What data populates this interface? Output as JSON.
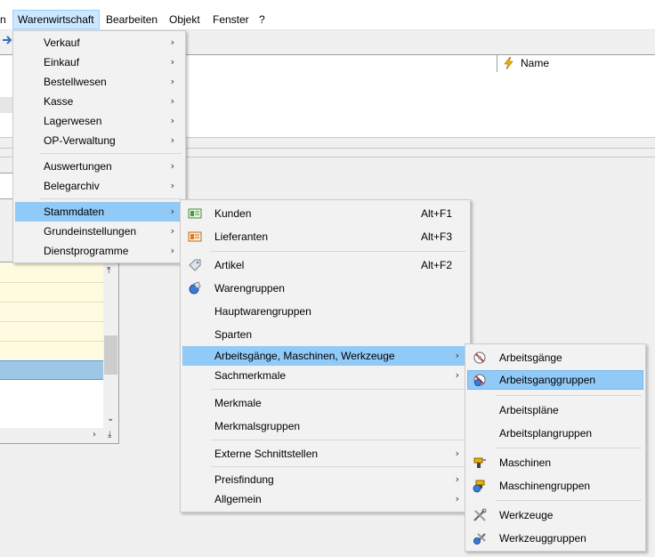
{
  "menubar": {
    "items": [
      "n",
      "Warenwirtschaft",
      "Bearbeiten",
      "Objekt",
      "Fenster",
      "?"
    ]
  },
  "grid": {
    "name_header": "Name"
  },
  "menu1": {
    "items": [
      {
        "label": "Verkauf",
        "arrow": "›"
      },
      {
        "label": "Einkauf",
        "arrow": "›"
      },
      {
        "label": "Bestellwesen",
        "arrow": "›"
      },
      {
        "label": "Kasse",
        "arrow": "›"
      },
      {
        "label": "Lagerwesen",
        "arrow": "›"
      },
      {
        "label": "OP-Verwaltung",
        "arrow": "›"
      },
      {
        "label": "Auswertungen",
        "arrow": "›"
      },
      {
        "label": "Belegarchiv",
        "arrow": "›"
      },
      {
        "label": "Stammdaten",
        "arrow": "›"
      },
      {
        "label": "Grundeinstellungen",
        "arrow": "›"
      },
      {
        "label": "Dienstprogramme",
        "arrow": "›"
      }
    ]
  },
  "menu2": {
    "items": [
      {
        "label": "Kunden",
        "shortcut": "Alt+F1",
        "icon": "customer-card-icon"
      },
      {
        "label": "Lieferanten",
        "shortcut": "Alt+F3",
        "icon": "supplier-card-icon"
      },
      {
        "label": "Artikel",
        "shortcut": "Alt+F2",
        "icon": "article-tag-icon"
      },
      {
        "label": "Warengruppen",
        "icon": "product-group-icon"
      },
      {
        "label": "Hauptwarengruppen"
      },
      {
        "label": "Sparten"
      },
      {
        "label": "Arbeitsgänge, Maschinen, Werkzeuge",
        "arrow": "›"
      },
      {
        "label": "Sachmerkmale",
        "arrow": "›"
      },
      {
        "label": "Merkmale"
      },
      {
        "label": "Merkmalsgruppen"
      },
      {
        "label": "Externe Schnittstellen",
        "arrow": "›"
      },
      {
        "label": "Preisfindung",
        "arrow": "›"
      },
      {
        "label": "Allgemein",
        "arrow": "›"
      }
    ]
  },
  "menu3": {
    "items": [
      {
        "label": "Arbeitsgänge",
        "icon": "work-step-icon"
      },
      {
        "label": "Arbeitsganggruppen",
        "icon": "work-step-group-icon"
      },
      {
        "label": "Arbeitspläne"
      },
      {
        "label": "Arbeitsplangruppen"
      },
      {
        "label": "Maschinen",
        "icon": "drill-machine-icon"
      },
      {
        "label": "Maschinengruppen",
        "icon": "machine-group-icon"
      },
      {
        "label": "Werkzeuge",
        "icon": "tools-icon"
      },
      {
        "label": "Werkzeuggruppen",
        "icon": "tool-group-icon"
      }
    ]
  },
  "colors": {
    "highlight": "#91c9f7",
    "menubar_active": "#cce8ff"
  }
}
